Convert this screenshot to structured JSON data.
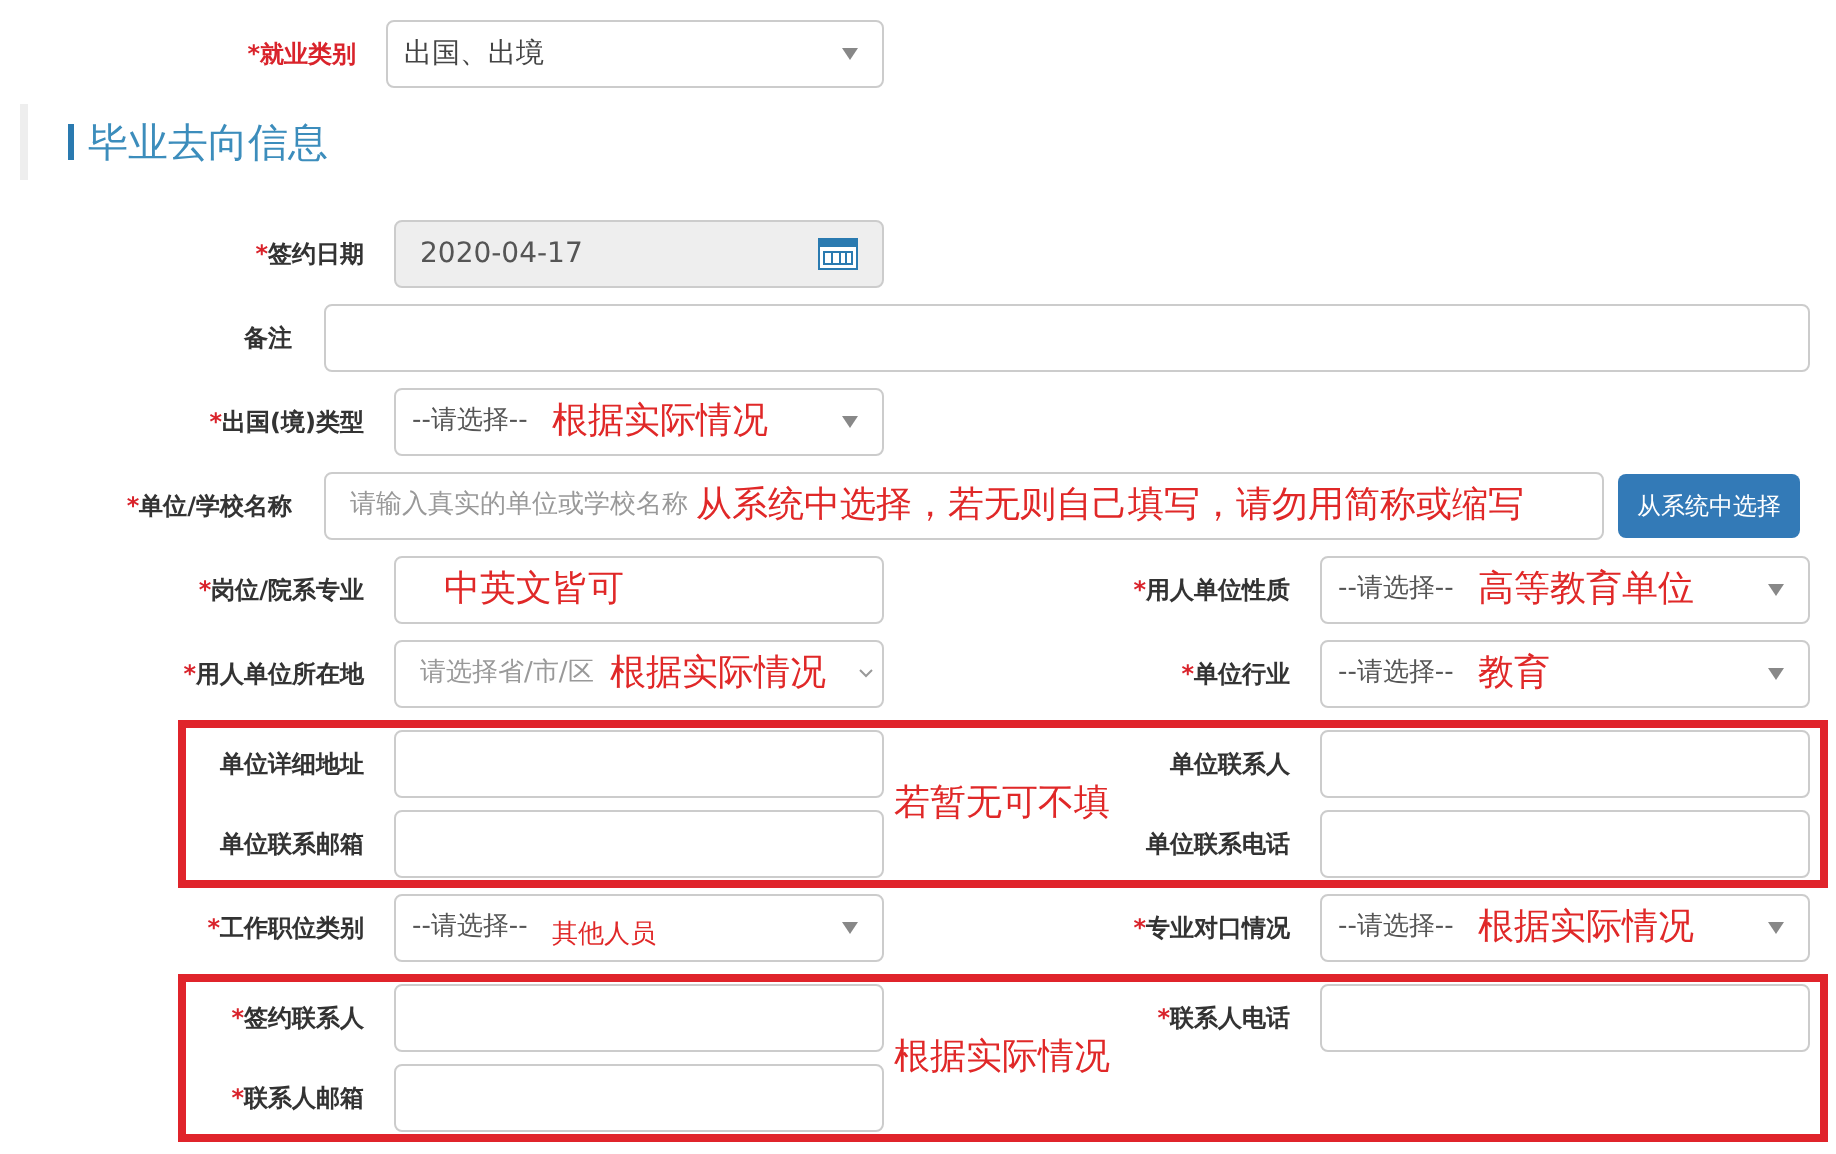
{
  "employment_category": {
    "mark": "*",
    "label": "就业类别",
    "value": "出国、出境"
  },
  "section_title": "毕业去向信息",
  "rows": [
    {
      "kind": "single",
      "field": {
        "kind": "date",
        "mark": "*",
        "label": "签约日期",
        "value": "2020-04-17",
        "disabled": true
      }
    },
    {
      "kind": "wide",
      "field": {
        "kind": "input",
        "label": "备注"
      }
    },
    {
      "kind": "single",
      "field": {
        "kind": "select",
        "mark": "*",
        "label": "出国(境)类型",
        "value": "--请选择--",
        "annotation": {
          "text": "根据实际情况",
          "kind": "large"
        }
      }
    },
    {
      "kind": "wide",
      "field": {
        "kind": "lookup",
        "mark": "*",
        "label": "单位/学校名称",
        "placeholder": "请输入真实的单位或学校名称",
        "annotation": {
          "text": "从系统中选择，若无则自己填写，请勿用简称或缩写",
          "kind": "large"
        },
        "button": "从系统中选择"
      }
    },
    {
      "kind": "pair",
      "left": {
        "kind": "input",
        "mark": "*",
        "label": "岗位/院系专业",
        "annotation": {
          "text": "中英文皆可",
          "kind": "large"
        }
      },
      "right": {
        "kind": "select",
        "mark": "*",
        "label": "用人单位性质",
        "value": "--请选择--",
        "annotation": {
          "text": "高等教育单位",
          "kind": "large"
        }
      }
    },
    {
      "kind": "pair",
      "left": {
        "kind": "region",
        "mark": "*",
        "label": "用人单位所在地",
        "placeholder": "请选择省/市/区",
        "annotation": {
          "text": "根据实际情况",
          "kind": "large"
        }
      },
      "right": {
        "kind": "select",
        "mark": "*",
        "label": "单位行业",
        "value": "--请选择--",
        "annotation": {
          "text": "教育",
          "kind": "large"
        }
      }
    },
    {
      "kind": "group",
      "annotation": {
        "text": "若暂无可不填",
        "kind": "large"
      },
      "rows": [
        {
          "left": {
            "kind": "input",
            "label": "单位详细地址"
          },
          "right": {
            "kind": "input",
            "label": "单位联系人"
          }
        },
        {
          "left": {
            "kind": "input",
            "label": "单位联系邮箱"
          },
          "right": {
            "kind": "input",
            "label": "单位联系电话"
          }
        }
      ]
    },
    {
      "kind": "pair",
      "left": {
        "kind": "select",
        "mark": "*",
        "label": "工作职位类别",
        "value": "--请选择--",
        "annotation": {
          "text": "其他人员",
          "kind": "small"
        }
      },
      "right": {
        "kind": "select",
        "mark": "*",
        "label": "专业对口情况",
        "value": "--请选择--",
        "annotation": {
          "text": "根据实际情况",
          "kind": "large"
        }
      }
    },
    {
      "kind": "group",
      "annotation": {
        "text": "根据实际情况",
        "kind": "large"
      },
      "rows": [
        {
          "left": {
            "kind": "input",
            "mark": "*",
            "label": "签约联系人"
          },
          "right": {
            "kind": "input",
            "mark": "*",
            "label": "联系人电话"
          }
        },
        {
          "left": {
            "kind": "input",
            "mark": "*",
            "label": "联系人邮箱"
          }
        }
      ]
    }
  ]
}
